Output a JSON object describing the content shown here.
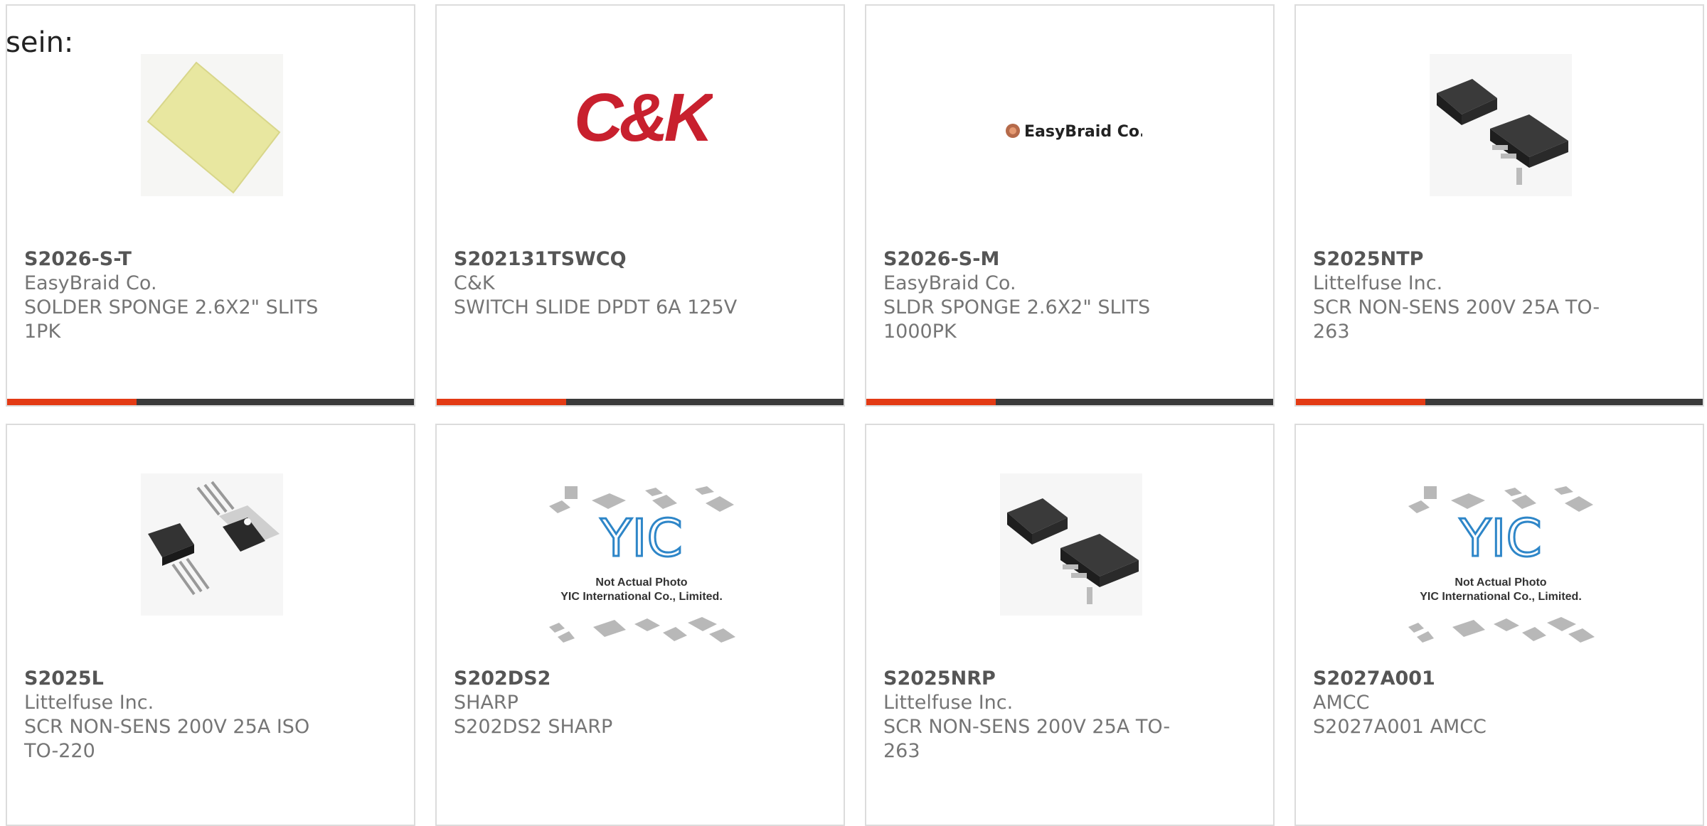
{
  "intro_text": "sein:",
  "accent_color": "#e33a14",
  "products": [
    {
      "part": "S2026-S-T",
      "maker": "EasyBraid Co.",
      "desc": "SOLDER SPONGE 2.6X2\" SLITS 1PK",
      "image": "yellow-sponge-image"
    },
    {
      "part": "S202131TSWCQ",
      "maker": "C&K",
      "desc": "SWITCH SLIDE DPDT 6A 125V",
      "image": "ck-logo",
      "logo_text": "C&K"
    },
    {
      "part": "S2026-S-M",
      "maker": "EasyBraid Co.",
      "desc": "SLDR SPONGE 2.6X2\" SLITS 1000PK",
      "image": "easybraid-logo",
      "logo_text": "EasyBraid Co."
    },
    {
      "part": "S2025NTP",
      "maker": "Littelfuse Inc.",
      "desc": "SCR NON-SENS 200V 25A TO-263",
      "image": "to263-package-image"
    },
    {
      "part": "S2025L",
      "maker": "Littelfuse Inc.",
      "desc": "SCR NON-SENS 200V 25A ISO TO-220",
      "image": "to220-package-image"
    },
    {
      "part": "S202DS2",
      "maker": "SHARP",
      "desc": "S202DS2 SHARP",
      "image": "yic-placeholder-image",
      "placeholder_line1": "Not Actual Photo",
      "placeholder_line2": "YIC International Co., Limited."
    },
    {
      "part": "S2025NRP",
      "maker": "Littelfuse Inc.",
      "desc": "SCR NON-SENS 200V 25A TO-263",
      "image": "to263-package-image"
    },
    {
      "part": "S2027A001",
      "maker": "AMCC",
      "desc": "S2027A001 AMCC",
      "image": "yic-placeholder-image",
      "placeholder_line1": "Not Actual Photo",
      "placeholder_line2": "YIC International Co., Limited."
    }
  ]
}
